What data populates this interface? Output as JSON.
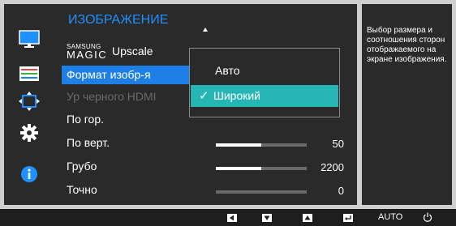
{
  "menu": {
    "title": "ИЗОБРАЖЕНИЕ",
    "magic_upscale": {
      "samsung": "SAMSUNG",
      "magic": "MAGIC",
      "upscale": "Upscale"
    },
    "items": [
      {
        "label": "Формат изобр-я"
      },
      {
        "label": "Ур черного HDMI"
      },
      {
        "label": "По гор."
      },
      {
        "label": "По верт.",
        "value": "50",
        "level": 0.5
      },
      {
        "label": "Грубо",
        "value": "2200",
        "level": 0.5
      },
      {
        "label": "Точно",
        "value": "0",
        "level": 0.0
      }
    ]
  },
  "dropdown": {
    "options": [
      {
        "label": "Авто",
        "selected": false
      },
      {
        "label": "Широкий",
        "selected": true
      }
    ],
    "check_icon": "✓"
  },
  "help": {
    "text": "Выбор размера и соотношения сторон отображаемого на экране изображения."
  },
  "sidebar": {
    "icons": [
      "monitor-icon",
      "color-settings-icon",
      "size-position-icon",
      "gear-icon",
      "info-icon"
    ]
  },
  "bottom_bar": {
    "auto_label": "AUTO",
    "buttons": [
      "left-arrow-button",
      "down-arrow-button",
      "up-arrow-button",
      "enter-button",
      "auto-button",
      "power-button"
    ]
  },
  "colors": {
    "accent_blue": "#1e7fe6",
    "dropdown_selected": "#26b5b5",
    "panel": "#2a2a2a",
    "frame": "#cfcfcf"
  }
}
